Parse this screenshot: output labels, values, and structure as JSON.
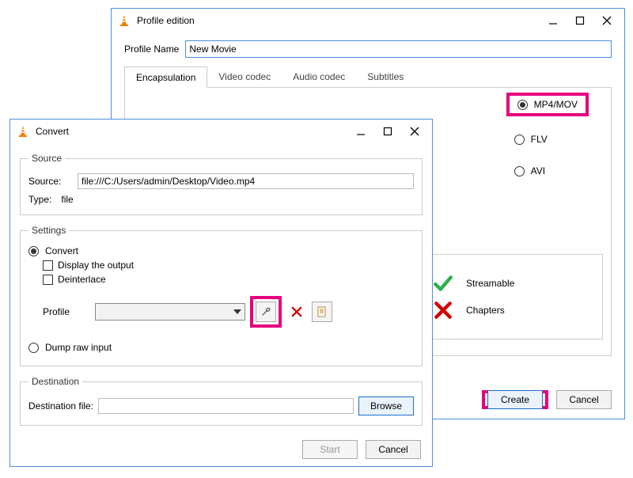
{
  "profile_window": {
    "title": "Profile edition",
    "name_label": "Profile Name",
    "name_value": "New Movie",
    "tabs": {
      "encapsulation": "Encapsulation",
      "video": "Video codec",
      "audio": "Audio codec",
      "subtitles": "Subtitles"
    },
    "formats": {
      "mp4": "MP4/MOV",
      "flv": "FLV",
      "avi": "AVI"
    },
    "features": {
      "streamable": "Streamable",
      "chapters": "Chapters"
    },
    "buttons": {
      "create": "Create",
      "cancel": "Cancel"
    }
  },
  "convert_window": {
    "title": "Convert",
    "source": {
      "legend": "Source",
      "source_label": "Source:",
      "source_value": "file:///C:/Users/admin/Desktop/Video.mp4",
      "type_label": "Type:",
      "type_value": "file"
    },
    "settings": {
      "legend": "Settings",
      "convert": "Convert",
      "display_output": "Display the output",
      "deinterlace": "Deinterlace",
      "profile_label": "Profile",
      "dump_raw": "Dump raw input"
    },
    "destination": {
      "legend": "Destination",
      "file_label": "Destination file:",
      "browse": "Browse"
    },
    "buttons": {
      "start": "Start",
      "cancel": "Cancel"
    }
  }
}
